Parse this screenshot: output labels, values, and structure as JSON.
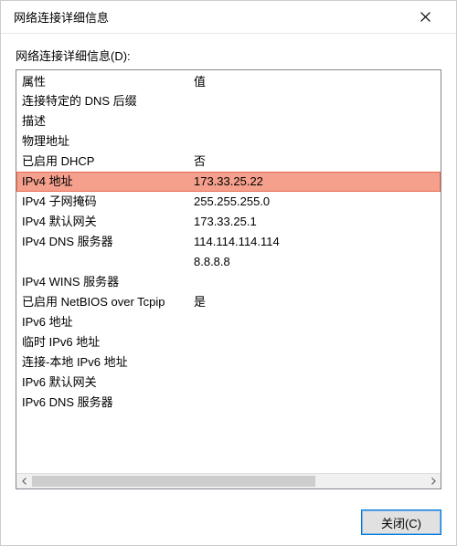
{
  "window": {
    "title": "网络连接详细信息"
  },
  "section_label": "网络连接详细信息(D):",
  "columns": {
    "property": "属性",
    "value": "值"
  },
  "rows": [
    {
      "property": "连接特定的 DNS 后缀",
      "value": ""
    },
    {
      "property": "描述",
      "value": ""
    },
    {
      "property": "物理地址",
      "value": ""
    },
    {
      "property": "已启用 DHCP",
      "value": "否"
    },
    {
      "property": "IPv4 地址",
      "value": "173.33.25.22",
      "highlight": true
    },
    {
      "property": "IPv4 子网掩码",
      "value": "255.255.255.0"
    },
    {
      "property": "IPv4 默认网关",
      "value": "173.33.25.1"
    },
    {
      "property": "IPv4 DNS 服务器",
      "value": "114.114.114.114"
    },
    {
      "property": "",
      "value": "8.8.8.8"
    },
    {
      "property": "IPv4 WINS 服务器",
      "value": ""
    },
    {
      "property": "已启用 NetBIOS over Tcpip",
      "value": "是"
    },
    {
      "property": "IPv6 地址",
      "value": ""
    },
    {
      "property": "临时 IPv6 地址",
      "value": ""
    },
    {
      "property": "连接-本地 IPv6 地址",
      "value": ""
    },
    {
      "property": "IPv6 默认网关",
      "value": ""
    },
    {
      "property": "IPv6 DNS 服务器",
      "value": ""
    }
  ],
  "buttons": {
    "close": "关闭(C)"
  }
}
